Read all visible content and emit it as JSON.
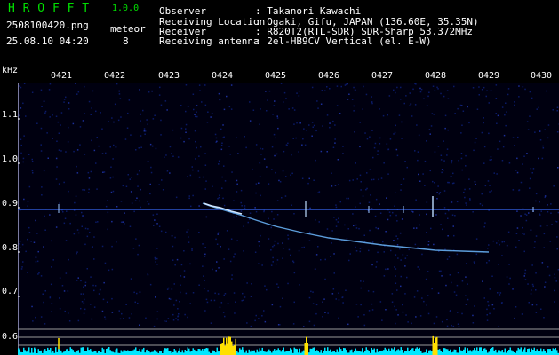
{
  "app": {
    "name": "H R O F F T",
    "version": "1.0.0"
  },
  "file": {
    "name": "2508100420.png",
    "datetime": "25.08.10 04:20"
  },
  "meteor": {
    "label": "meteor",
    "count": "8"
  },
  "info": [
    {
      "label": "Observer",
      "value": ": Takanori Kawachi"
    },
    {
      "label": "Receiving Location",
      "value": ": Ogaki, Gifu, JAPAN (136.60E, 35.35N)"
    },
    {
      "label": "Receiver",
      "value": ": R820T2(RTL-SDR) SDR-Sharp 53.372MHz"
    },
    {
      "label": "Receiving antenna",
      "value": ": 2el-HB9CV Vertical (el. E-W)"
    }
  ],
  "axis": {
    "unit": "kHz",
    "time_ticks": [
      "0421",
      "0422",
      "0423",
      "0424",
      "0425",
      "0426",
      "0427",
      "0428",
      "0429",
      "0430"
    ],
    "freq_ticks": [
      "1.1",
      "1.0",
      "0.9",
      "0.8",
      "0.7",
      "0.6"
    ]
  },
  "colors": {
    "background": "#000010",
    "noise": "#0a1a66",
    "signal": "#5aa8ff",
    "header_green": "#00e000",
    "spectrum_cyan": "#00e8ff",
    "spectrum_yellow": "#ffe000"
  }
}
